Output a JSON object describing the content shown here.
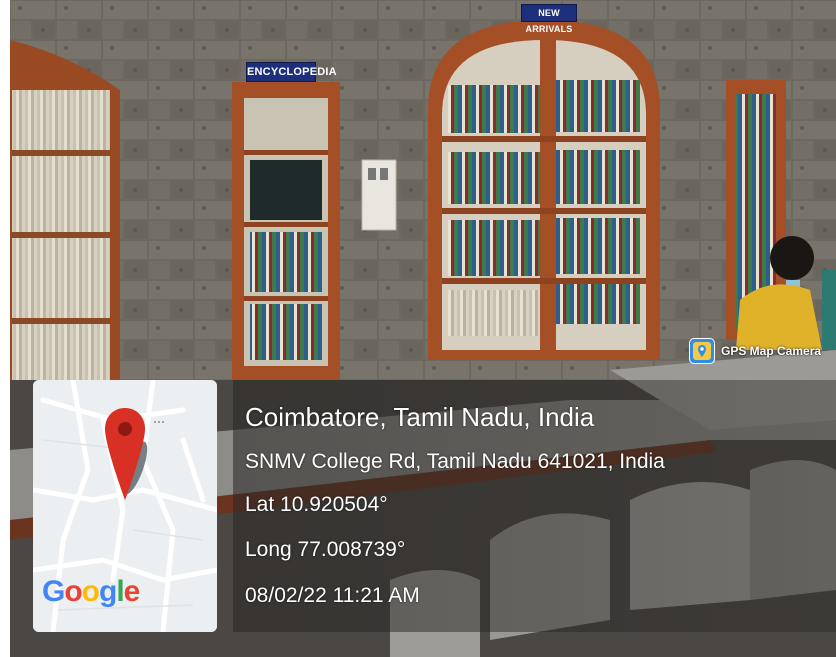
{
  "signs": {
    "encyclopedia": "ENCYCLOPEDIA",
    "new_arrivals": "NEW ARRIVALS"
  },
  "gps_badge": {
    "icon": "gps-map-camera-icon",
    "label": "GPS Map Camera"
  },
  "map_card": {
    "pin_icon": "map-pin-icon",
    "logo_text": "Google",
    "pin_color": "#d93025"
  },
  "location": {
    "title": "Coimbatore, Tamil Nadu, India",
    "address": "SNMV College Rd, Tamil Nadu 641021, India",
    "latitude": "Lat 10.920504°",
    "longitude": "Long 77.008739°",
    "timestamp": "08/02/22 11:21 AM"
  }
}
